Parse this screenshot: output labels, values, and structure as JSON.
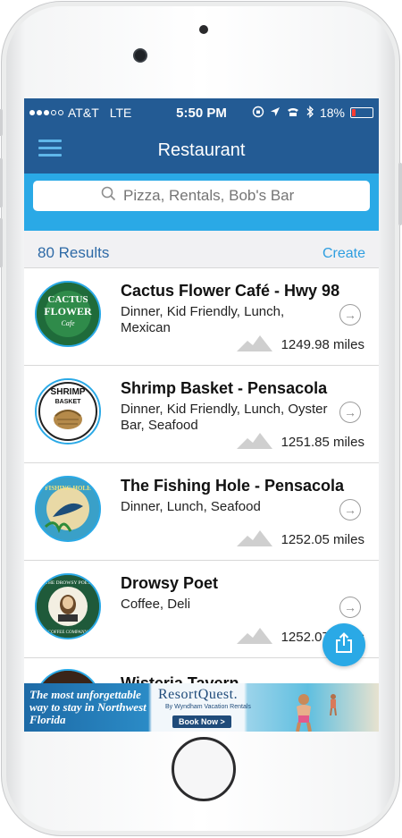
{
  "status_bar": {
    "carrier": "AT&T",
    "network": "LTE",
    "time": "5:50 PM",
    "battery": "18%",
    "battery_level": 0.18,
    "battery_color": "#ff3b30"
  },
  "nav": {
    "title": "Restaurant",
    "menu_icon": "hamburger-menu-icon"
  },
  "search": {
    "placeholder": "Pizza, Rentals, Bob's Bar",
    "icon": "search-icon"
  },
  "results": {
    "count_label": "80 Results",
    "create_label": "Create"
  },
  "restaurants": [
    {
      "name": "Cactus Flower Café - Hwy 98",
      "tags": "Dinner, Kid Friendly, Lunch, Mexican",
      "distance": "1249.98 miles",
      "logo_lines": [
        "CACTUS",
        "FLOWER",
        "Cafe"
      ]
    },
    {
      "name": "Shrimp Basket - Pensacola",
      "tags": "Dinner, Kid Friendly, Lunch, Oyster Bar, Seafood",
      "distance": "1251.85 miles",
      "logo_lines": [
        "SHRIMP",
        "BASKET"
      ]
    },
    {
      "name": "The Fishing Hole - Pensacola",
      "tags": "Dinner, Lunch, Seafood",
      "distance": "1252.05 miles",
      "logo_lines": [
        "FISHING HOLE"
      ]
    },
    {
      "name": "Drowsy Poet",
      "tags": "Coffee, Deli",
      "distance": "1252.07 miles",
      "logo_lines": [
        "THE DROWSY POET",
        "COFFEE COMPANY"
      ]
    },
    {
      "name": "Wisteria Tavern",
      "tags": "",
      "distance": "",
      "logo_lines": []
    }
  ],
  "ad": {
    "tagline": "The most unforgettable way to stay in Northwest Florida",
    "brand": "ResortQuest.",
    "sub": "By Wyndham Vacation Rentals",
    "cta": "Book Now >"
  },
  "colors": {
    "nav_blue": "#235b94",
    "accent": "#2aa9e6",
    "link": "#2e9ee0"
  }
}
